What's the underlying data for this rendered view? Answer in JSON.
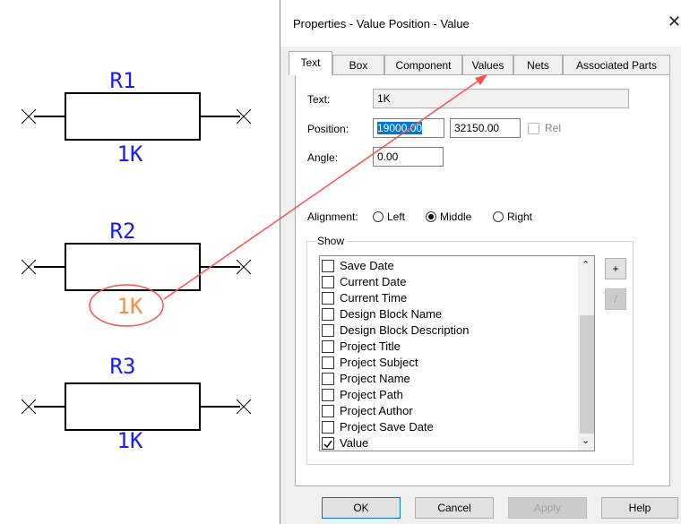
{
  "schematic": {
    "components": [
      {
        "ref": "R1",
        "value": "1K",
        "highlighted": false
      },
      {
        "ref": "R2",
        "value": "1K",
        "highlighted": true
      },
      {
        "ref": "R3",
        "value": "1K",
        "highlighted": false
      }
    ],
    "ref_color": "#1a1aff",
    "highlight_color": "#ff8c3a",
    "annotation_color": "#ff4d4d"
  },
  "dialog": {
    "title": "Properties - Value Position - Value",
    "close_glyph": "✕",
    "tabs": [
      {
        "label": "Text",
        "active": true
      },
      {
        "label": "Box",
        "active": false
      },
      {
        "label": "Component",
        "active": false
      },
      {
        "label": "Values",
        "active": false
      },
      {
        "label": "Nets",
        "active": false
      },
      {
        "label": "Associated Parts",
        "active": false
      }
    ],
    "text_label": "Text:",
    "text_value": "1K",
    "position_label": "Position:",
    "position_x": "19000.00",
    "position_y": "32150.00",
    "rel_label": "Rel",
    "rel_checked": false,
    "angle_label": "Angle:",
    "angle_value": "0.00",
    "alignment_label": "Alignment:",
    "alignment_options": [
      {
        "label": "Left",
        "selected": false
      },
      {
        "label": "Middle",
        "selected": true
      },
      {
        "label": "Right",
        "selected": false
      }
    ],
    "show_label": "Show",
    "show_items": [
      {
        "label": "Save Date",
        "checked": false
      },
      {
        "label": "Current Date",
        "checked": false
      },
      {
        "label": "Current Time",
        "checked": false
      },
      {
        "label": "Design Block Name",
        "checked": false
      },
      {
        "label": "Design Block Description",
        "checked": false
      },
      {
        "label": "Project Title",
        "checked": false
      },
      {
        "label": "Project Subject",
        "checked": false
      },
      {
        "label": "Project Name",
        "checked": false
      },
      {
        "label": "Project Path",
        "checked": false
      },
      {
        "label": "Project Author",
        "checked": false
      },
      {
        "label": "Project Save Date",
        "checked": false
      },
      {
        "label": "Value",
        "checked": true
      }
    ],
    "add_label": "+",
    "edit_label": "/",
    "buttons": {
      "ok": "OK",
      "cancel": "Cancel",
      "apply": "Apply",
      "help": "Help"
    }
  }
}
